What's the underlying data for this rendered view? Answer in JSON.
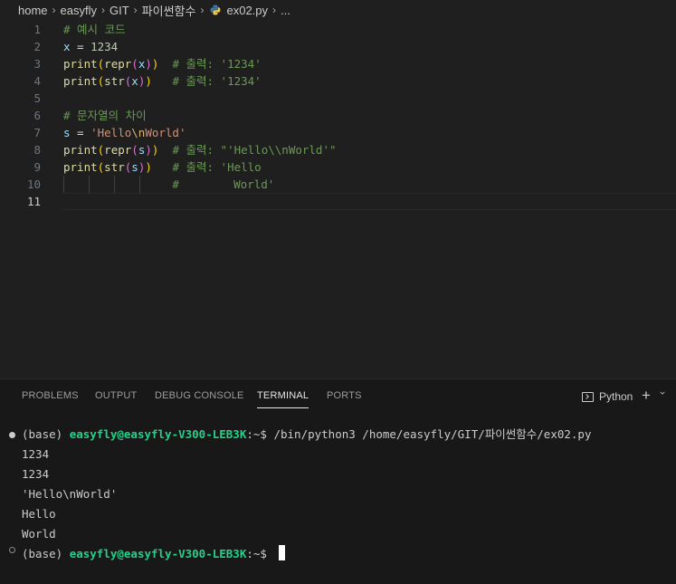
{
  "breadcrumb": {
    "items": [
      "home",
      "easyfly",
      "GIT",
      "파이썬함수",
      "ex02.py",
      "..."
    ],
    "file_icon": "python-file-icon"
  },
  "editor": {
    "line_numbers": [
      "1",
      "2",
      "3",
      "4",
      "5",
      "6",
      "7",
      "8",
      "9",
      "10",
      "11"
    ],
    "active_line": "11",
    "lines": [
      [
        {
          "t": "# 예시 코드",
          "c": "t-cmt"
        }
      ],
      [
        {
          "t": "x",
          "c": "t-var"
        },
        {
          "t": " = ",
          "c": "t-op"
        },
        {
          "t": "1234",
          "c": "t-num"
        }
      ],
      [
        {
          "t": "print",
          "c": "t-fn"
        },
        {
          "t": "(",
          "c": "t-p1"
        },
        {
          "t": "repr",
          "c": "t-fn"
        },
        {
          "t": "(",
          "c": "t-p2"
        },
        {
          "t": "x",
          "c": "t-var"
        },
        {
          "t": ")",
          "c": "t-p2"
        },
        {
          "t": ")",
          "c": "t-p1"
        },
        {
          "t": "  # 출력: '1234'",
          "c": "t-cmt"
        }
      ],
      [
        {
          "t": "print",
          "c": "t-fn"
        },
        {
          "t": "(",
          "c": "t-p1"
        },
        {
          "t": "str",
          "c": "t-fn"
        },
        {
          "t": "(",
          "c": "t-p2"
        },
        {
          "t": "x",
          "c": "t-var"
        },
        {
          "t": ")",
          "c": "t-p2"
        },
        {
          "t": ")",
          "c": "t-p1"
        },
        {
          "t": "   # 출력: '1234'",
          "c": "t-cmt"
        }
      ],
      [],
      [
        {
          "t": "# 문자열의 차이",
          "c": "t-cmt"
        }
      ],
      [
        {
          "t": "s",
          "c": "t-var"
        },
        {
          "t": " = ",
          "c": "t-op"
        },
        {
          "t": "'Hello",
          "c": "t-str"
        },
        {
          "t": "\\n",
          "c": "t-esc"
        },
        {
          "t": "World'",
          "c": "t-str"
        }
      ],
      [
        {
          "t": "print",
          "c": "t-fn"
        },
        {
          "t": "(",
          "c": "t-p1"
        },
        {
          "t": "repr",
          "c": "t-fn"
        },
        {
          "t": "(",
          "c": "t-p2"
        },
        {
          "t": "s",
          "c": "t-var"
        },
        {
          "t": ")",
          "c": "t-p2"
        },
        {
          "t": ")",
          "c": "t-p1"
        },
        {
          "t": "  # 출력: \"'Hello\\\\nWorld'\"",
          "c": "t-cmt"
        }
      ],
      [
        {
          "t": "print",
          "c": "t-fn"
        },
        {
          "t": "(",
          "c": "t-p1"
        },
        {
          "t": "str",
          "c": "t-fn"
        },
        {
          "t": "(",
          "c": "t-p2"
        },
        {
          "t": "s",
          "c": "t-var"
        },
        {
          "t": ")",
          "c": "t-p2"
        },
        {
          "t": ")",
          "c": "t-p1"
        },
        {
          "t": "   # 출력: 'Hello",
          "c": "t-cmt"
        }
      ],
      [
        {
          "t": "                #        World'",
          "c": "t-cmt"
        }
      ],
      []
    ]
  },
  "panel": {
    "tabs": [
      "PROBLEMS",
      "OUTPUT",
      "DEBUG CONSOLE",
      "TERMINAL",
      "PORTS"
    ],
    "active_tab": "TERMINAL",
    "shell_label": "Python",
    "new_terminal_symbol": "+",
    "terminal": {
      "prompt_env": "(base) ",
      "prompt_user": "easyfly@easyfly-V300-LEB3K",
      "prompt_suffix": ":~$ ",
      "command": "/bin/python3 /home/easyfly/GIT/파이썬함수/ex02.py",
      "output": [
        "1234",
        "1234",
        "'Hello\\nWorld'",
        "Hello",
        "World"
      ]
    }
  },
  "colors": {
    "background": "#1f1f1f",
    "panel_background": "#181818",
    "comment": "#6a9955",
    "function": "#dcdcaa",
    "variable": "#9cdcfe",
    "number": "#b5cea8",
    "string": "#ce9178",
    "terminal_user": "#23d18b"
  }
}
